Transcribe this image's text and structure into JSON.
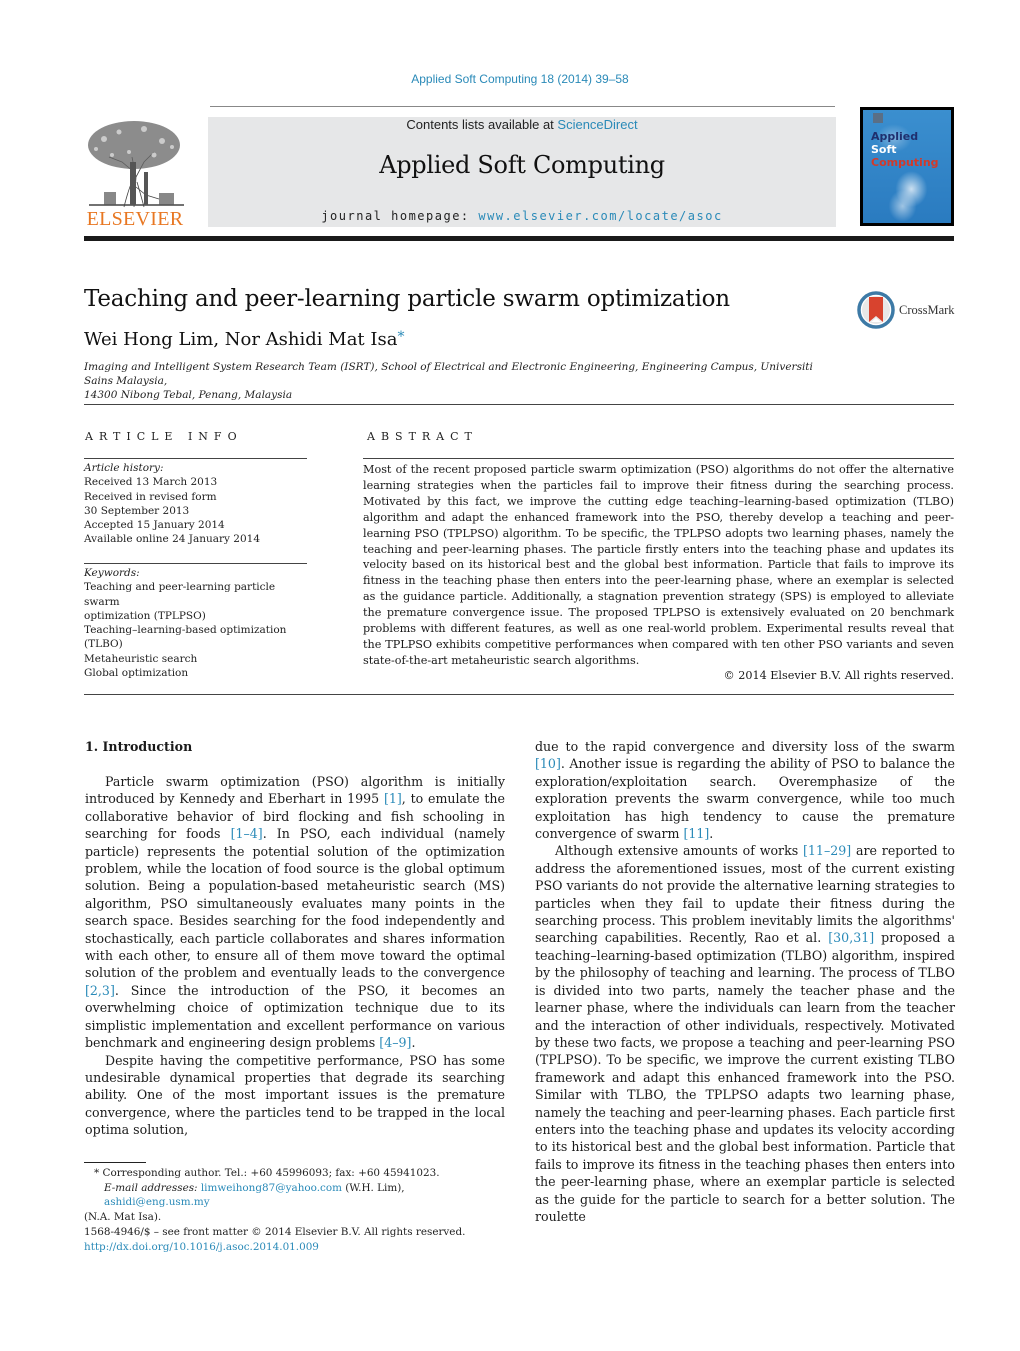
{
  "header": {
    "journal_reference": "Applied Soft Computing 18 (2014) 39–58",
    "publisher_logo_text": "ELSEVIER",
    "contents_prefix": "Contents lists available at ",
    "contents_link": "ScienceDirect",
    "journal_title": "Applied Soft Computing",
    "homepage_prefix": "journal homepage: ",
    "homepage_link": "www.elsevier.com/locate/asoc",
    "cover": {
      "line1": "Applied",
      "line2": "Soft",
      "line3": "Computing",
      "colors": {
        "line1": "#1f2f6e",
        "line2": "#ffffff",
        "line3": "#d23a2a",
        "background": "#2f85c8"
      }
    }
  },
  "article": {
    "title": "Teaching and peer-learning particle swarm optimization",
    "crossmark_label": "CrossMark",
    "authors": "Wei Hong Lim, Nor Ashidi Mat Isa",
    "corresponding_marker": "*",
    "affiliation_line1": "Imaging and Intelligent System Research Team (ISRT), School of Electrical and Electronic Engineering, Engineering Campus, Universiti Sains Malaysia,",
    "affiliation_line2": "14300 Nibong Tebal, Penang, Malaysia"
  },
  "article_info": {
    "heading": "ARTICLE INFO",
    "history_label": "Article history:",
    "history": [
      "Received 13 March 2013",
      "Received in revised form",
      "30 September 2013",
      "Accepted 15 January 2014",
      "Available online 24 January 2014"
    ],
    "keywords_label": "Keywords:",
    "keywords": [
      "Teaching and peer-learning particle swarm",
      "optimization (TPLPSO)",
      "Teaching–learning-based optimization",
      "(TLBO)",
      "Metaheuristic search",
      "Global optimization"
    ]
  },
  "abstract": {
    "heading": "ABSTRACT",
    "text": "Most of the recent proposed particle swarm optimization (PSO) algorithms do not offer the alternative learning strategies when the particles fail to improve their fitness during the searching process. Motivated by this fact, we improve the cutting edge teaching–learning-based optimization (TLBO) algorithm and adapt the enhanced framework into the PSO, thereby develop a teaching and peer-learning PSO (TPLPSO) algorithm. To be specific, the TPLPSO adopts two learning phases, namely the teaching and peer-learning phases. The particle firstly enters into the teaching phase and updates its velocity based on its historical best and the global best information. Particle that fails to improve its fitness in the teaching phase then enters into the peer-learning phase, where an exemplar is selected as the guidance particle. Additionally, a stagnation prevention strategy (SPS) is employed to alleviate the premature convergence issue. The proposed TPLPSO is extensively evaluated on 20 benchmark problems with different features, as well as one real-world problem. Experimental results reveal that the TPLPSO exhibits competitive performances when compared with ten other PSO variants and seven state-of-the-art metaheuristic search algorithms.",
    "copyright": "© 2014 Elsevier B.V. All rights reserved."
  },
  "body": {
    "section_heading": "1.  Introduction",
    "left": {
      "p1": [
        "Particle swarm optimization (PSO) algorithm is initially introduced by Kennedy and Eberhart in 1995 ",
        "[1]",
        ", to emulate the collaborative behavior of bird flocking and fish schooling in searching for foods ",
        "[1–4]",
        ". In PSO, each individual (namely particle) represents the potential solution of the optimization problem, while the location of food source is the global optimum solution. Being a population-based metaheuristic search (MS) algorithm, PSO simultaneously evaluates many points in the search space. Besides searching for the food independently and stochastically, each particle collaborates and shares information with each other, to ensure all of them move toward the optimal solution of the problem and eventually leads to the convergence ",
        "[2,3]",
        ". Since the introduction of the PSO, it becomes an overwhelming choice of optimization technique due to its simplistic implementation and excellent performance on various benchmark and engineering design problems ",
        "[4–9]",
        "."
      ],
      "p2": "Despite having the competitive performance, PSO has some undesirable dynamical properties that degrade its searching ability. One of the most important issues is the premature convergence, where the particles tend to be trapped in the local optima solution,"
    },
    "right": {
      "p1": [
        "due to the rapid convergence and diversity loss of the swarm ",
        "[10]",
        ". Another issue is regarding the ability of PSO to balance the exploration/exploitation search. Overemphasize of the exploration prevents the swarm convergence, while too much exploitation has high tendency to cause the premature convergence of swarm ",
        "[11]",
        "."
      ],
      "p2": [
        "Although extensive amounts of works ",
        "[11–29]",
        " are reported to address the aforementioned issues, most of the current existing PSO variants do not provide the alternative learning strategies to particles when they fail to update their fitness during the searching process. This problem inevitably limits the algorithms' searching capabilities. Recently, Rao et al. ",
        "[30,31]",
        " proposed a teaching–learning-based optimization (TLBO) algorithm, inspired by the philosophy of teaching and learning. The process of TLBO is divided into two parts, namely the teacher phase and the learner phase, where the individuals can learn from the teacher and the interaction of other individuals, respectively. Motivated by these two facts, we propose a teaching and peer-learning PSO (TPLPSO). To be specific, we improve the current existing TLBO framework and adapt this enhanced framework into the PSO. Similar with TLBO, the TPLPSO adapts two learning phase, namely the teaching and peer-learning phases. Each particle first enters into the teaching phase and updates its velocity according to its historical best and the global best information. Particle that fails to improve its fitness in the teaching phases then enters into the peer-learning phase, where an exemplar particle is selected as the guide for the particle to search for a better solution. The roulette"
      ]
    }
  },
  "footnotes": {
    "corresponding": "*  Corresponding author. Tel.: +60 45996093; fax: +60 45941023.",
    "email_label": "E-mail addresses: ",
    "email1": "limweihong87@yahoo.com",
    "email1_owner": " (W.H. Lim), ",
    "email2": "ashidi@eng.usm.my",
    "email2_owner": "(N.A. Mat Isa).",
    "front_matter": "1568-4946/$ – see front matter © 2014 Elsevier B.V. All rights reserved.",
    "doi": "http://dx.doi.org/10.1016/j.asoc.2014.01.009"
  },
  "colors": {
    "link": "#2a8ab8",
    "elsevier_orange": "#e87722",
    "banner_gray": "#e6e7e8"
  }
}
